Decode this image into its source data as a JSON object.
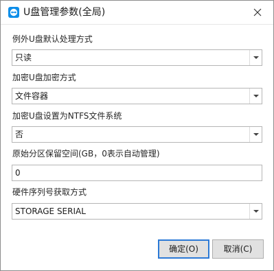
{
  "window": {
    "title": "U盘管理参数(全局)",
    "icon": "teamviewer-icon",
    "accent": "#0e8ee9"
  },
  "fields": {
    "exception_handling": {
      "label": "例外U盘默认处理方式",
      "value": "只读"
    },
    "encryption_method": {
      "label": "加密U盘加密方式",
      "value": "文件容器"
    },
    "ntfs_setting": {
      "label": "加密U盘设置为NTFS文件系统",
      "value": "否"
    },
    "reserved_space": {
      "label": "原始分区保留空间(GB，0表示自动管理)",
      "value": "0"
    },
    "hardware_serial": {
      "label": "硬件序列号获取方式",
      "value": "STORAGE SERIAL"
    }
  },
  "buttons": {
    "ok": "确定(O)",
    "cancel": "取消(C)"
  }
}
